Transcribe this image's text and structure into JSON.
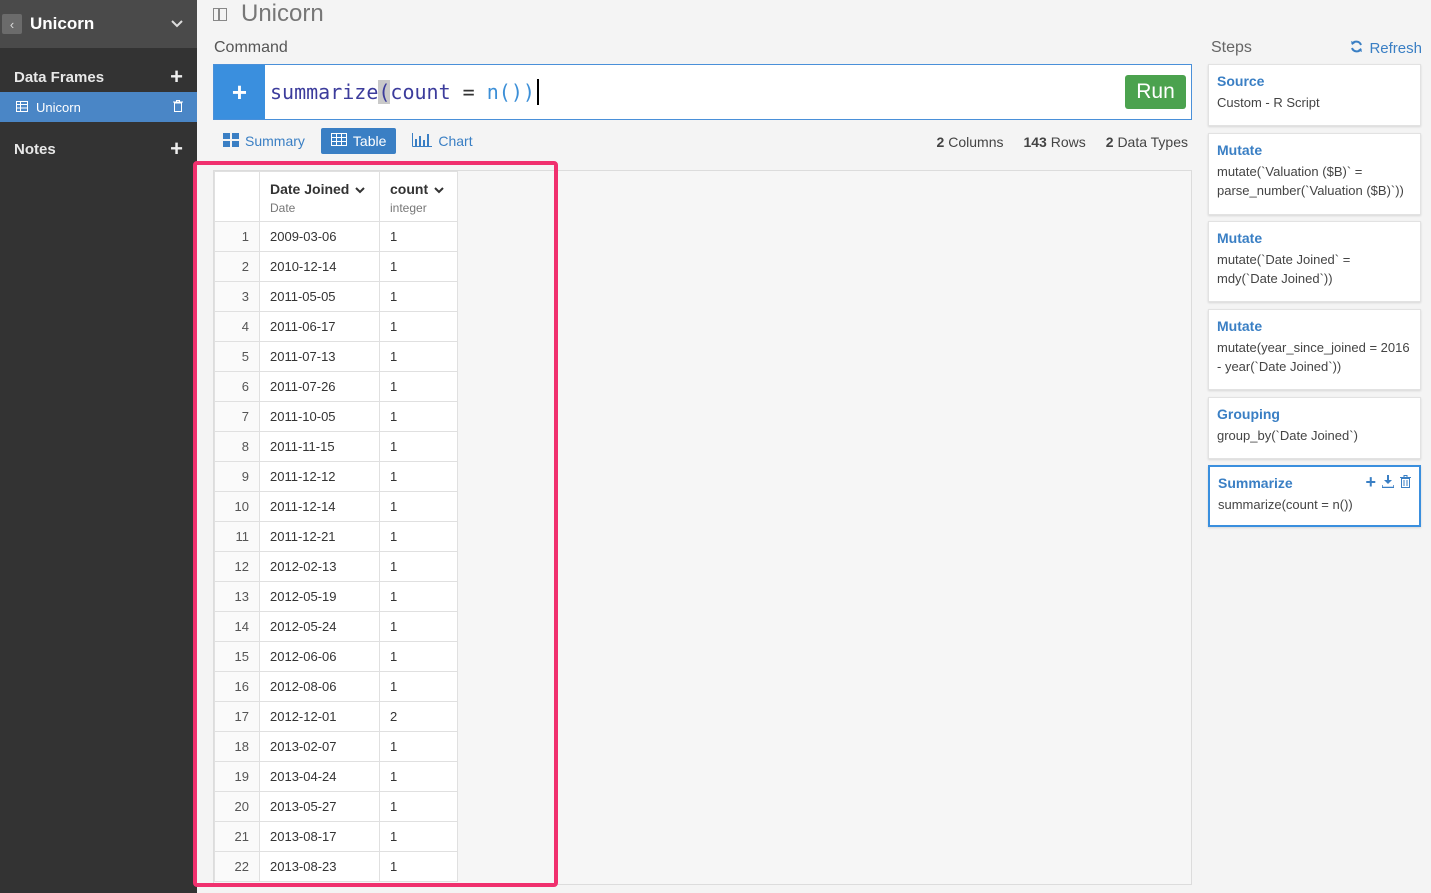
{
  "sidebar": {
    "project": "Unicorn",
    "data_frames_label": "Data Frames",
    "frames": [
      {
        "label": "Unicorn"
      }
    ],
    "notes_label": "Notes"
  },
  "main": {
    "title": "Unicorn",
    "command_label": "Command",
    "command": {
      "fn": "summarize",
      "open": "(",
      "arg": "count",
      "op": " = ",
      "call": "n()",
      "close": ")"
    },
    "run_label": "Run",
    "tabs": {
      "summary": "Summary",
      "table": "Table",
      "chart": "Chart"
    },
    "stats": {
      "columns_num": "2",
      "columns_label": "Columns",
      "rows_num": "143",
      "rows_label": "Rows",
      "types_num": "2",
      "types_label": "Data Types"
    },
    "table": {
      "columns": [
        {
          "name": "Date Joined",
          "type": "Date"
        },
        {
          "name": "count",
          "type": "integer"
        }
      ],
      "rows": [
        [
          "1",
          "2009-03-06",
          "1"
        ],
        [
          "2",
          "2010-12-14",
          "1"
        ],
        [
          "3",
          "2011-05-05",
          "1"
        ],
        [
          "4",
          "2011-06-17",
          "1"
        ],
        [
          "5",
          "2011-07-13",
          "1"
        ],
        [
          "6",
          "2011-07-26",
          "1"
        ],
        [
          "7",
          "2011-10-05",
          "1"
        ],
        [
          "8",
          "2011-11-15",
          "1"
        ],
        [
          "9",
          "2011-12-12",
          "1"
        ],
        [
          "10",
          "2011-12-14",
          "1"
        ],
        [
          "11",
          "2011-12-21",
          "1"
        ],
        [
          "12",
          "2012-02-13",
          "1"
        ],
        [
          "13",
          "2012-05-19",
          "1"
        ],
        [
          "14",
          "2012-05-24",
          "1"
        ],
        [
          "15",
          "2012-06-06",
          "1"
        ],
        [
          "16",
          "2012-08-06",
          "1"
        ],
        [
          "17",
          "2012-12-01",
          "2"
        ],
        [
          "18",
          "2013-02-07",
          "1"
        ],
        [
          "19",
          "2013-04-24",
          "1"
        ],
        [
          "20",
          "2013-05-27",
          "1"
        ],
        [
          "21",
          "2013-08-17",
          "1"
        ],
        [
          "22",
          "2013-08-23",
          "1"
        ]
      ]
    }
  },
  "steps": {
    "title": "Steps",
    "refresh_label": "Refresh",
    "items": [
      {
        "name": "Source",
        "desc": "Custom - R Script"
      },
      {
        "name": "Mutate",
        "desc": "mutate(`Valuation ($B)` = parse_number(`Valuation ($B)`))"
      },
      {
        "name": "Mutate",
        "desc": "mutate(`Date Joined` = mdy(`Date Joined`))"
      },
      {
        "name": "Mutate",
        "desc": "mutate(year_since_joined = 2016 - year(`Date Joined`))"
      },
      {
        "name": "Grouping",
        "desc": "group_by(`Date Joined`)"
      },
      {
        "name": "Summarize",
        "desc": "summarize(count = n())"
      }
    ]
  },
  "colors": {
    "accent": "#3a7fc4",
    "run": "#4ba24e",
    "highlight": "#f0306e",
    "sidebar": "#333333"
  }
}
